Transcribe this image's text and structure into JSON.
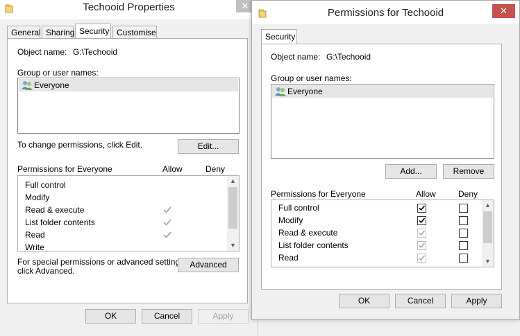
{
  "properties": {
    "title": "Techooid Properties",
    "close_glyph": "✕",
    "tabs": [
      "General",
      "Sharing",
      "Security",
      "Customise"
    ],
    "object_name_label": "Object name:",
    "object_name_value": "G:\\Techooid",
    "group_label": "Group or user names:",
    "users": [
      "Everyone"
    ],
    "change_hint": "To change permissions, click Edit.",
    "edit_label": "Edit...",
    "permissions_label": "Permissions for Everyone",
    "allow_header": "Allow",
    "deny_header": "Deny",
    "permissions": [
      {
        "name": "Full control",
        "allow": false
      },
      {
        "name": "Modify",
        "allow": false
      },
      {
        "name": "Read & execute",
        "allow": true
      },
      {
        "name": "List folder contents",
        "allow": true
      },
      {
        "name": "Read",
        "allow": true
      },
      {
        "name": "Write",
        "allow": false
      }
    ],
    "special_hint_1": "For special permissions or advanced settings,",
    "special_hint_2": "click Advanced.",
    "advanced_label": "Advanced",
    "ok_label": "OK",
    "cancel_label": "Cancel",
    "apply_label": "Apply"
  },
  "permissions_dialog": {
    "title": "Permissions for Techooid",
    "close_glyph": "✕",
    "tab": "Security",
    "object_name_label": "Object name:",
    "object_name_value": "G:\\Techooid",
    "group_label": "Group or user names:",
    "users": [
      "Everyone"
    ],
    "add_label": "Add...",
    "remove_label": "Remove",
    "permissions_label": "Permissions for Everyone",
    "allow_header": "Allow",
    "deny_header": "Deny",
    "permissions": [
      {
        "name": "Full control",
        "allow": true,
        "allow_enabled": true,
        "deny": false
      },
      {
        "name": "Modify",
        "allow": true,
        "allow_enabled": true,
        "deny": false
      },
      {
        "name": "Read & execute",
        "allow": true,
        "allow_enabled": false,
        "deny": false
      },
      {
        "name": "List folder contents",
        "allow": true,
        "allow_enabled": false,
        "deny": false
      },
      {
        "name": "Read",
        "allow": true,
        "allow_enabled": false,
        "deny": false
      }
    ],
    "ok_label": "OK",
    "cancel_label": "Cancel",
    "apply_label": "Apply"
  },
  "colors": {
    "close_active": "#c75050",
    "list_selection": "#e5e5e5",
    "disabled_text": "#a0a0a0"
  }
}
